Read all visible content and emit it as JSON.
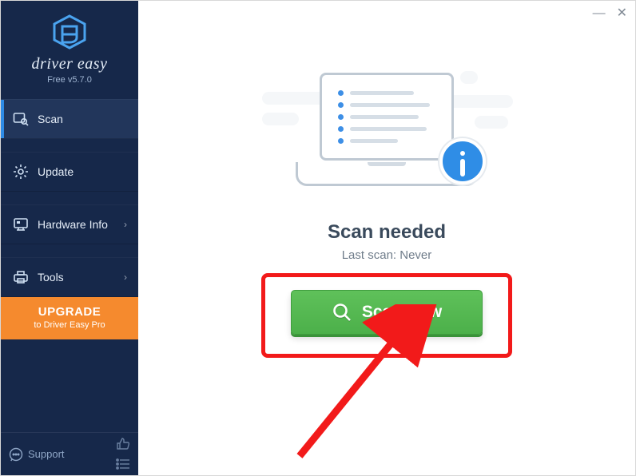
{
  "app": {
    "title": "driver easy",
    "version_label": "Free v5.7.0"
  },
  "sidebar": {
    "items": [
      {
        "label": "Scan",
        "icon": "scan-icon",
        "active": true,
        "has_submenu": false
      },
      {
        "label": "Update",
        "icon": "gear-icon",
        "active": false,
        "has_submenu": false
      },
      {
        "label": "Hardware Info",
        "icon": "monitor-icon",
        "active": false,
        "has_submenu": true
      },
      {
        "label": "Tools",
        "icon": "printer-icon",
        "active": false,
        "has_submenu": true
      }
    ],
    "upgrade": {
      "title": "UPGRADE",
      "subtitle": "to Driver Easy Pro"
    },
    "footer": {
      "support_label": "Support"
    }
  },
  "main": {
    "headline": "Scan needed",
    "last_scan_label": "Last scan: Never",
    "scan_button_label": "Scan Now"
  },
  "annotations": {
    "callout": "red-highlight-box",
    "arrow": "red-arrow"
  },
  "colors": {
    "sidebar_bg": "#16284a",
    "accent_blue": "#2f8de6",
    "upgrade_bg": "#f58a2e",
    "scan_green": "#4cb04a",
    "highlight_red": "#f21a1a"
  }
}
